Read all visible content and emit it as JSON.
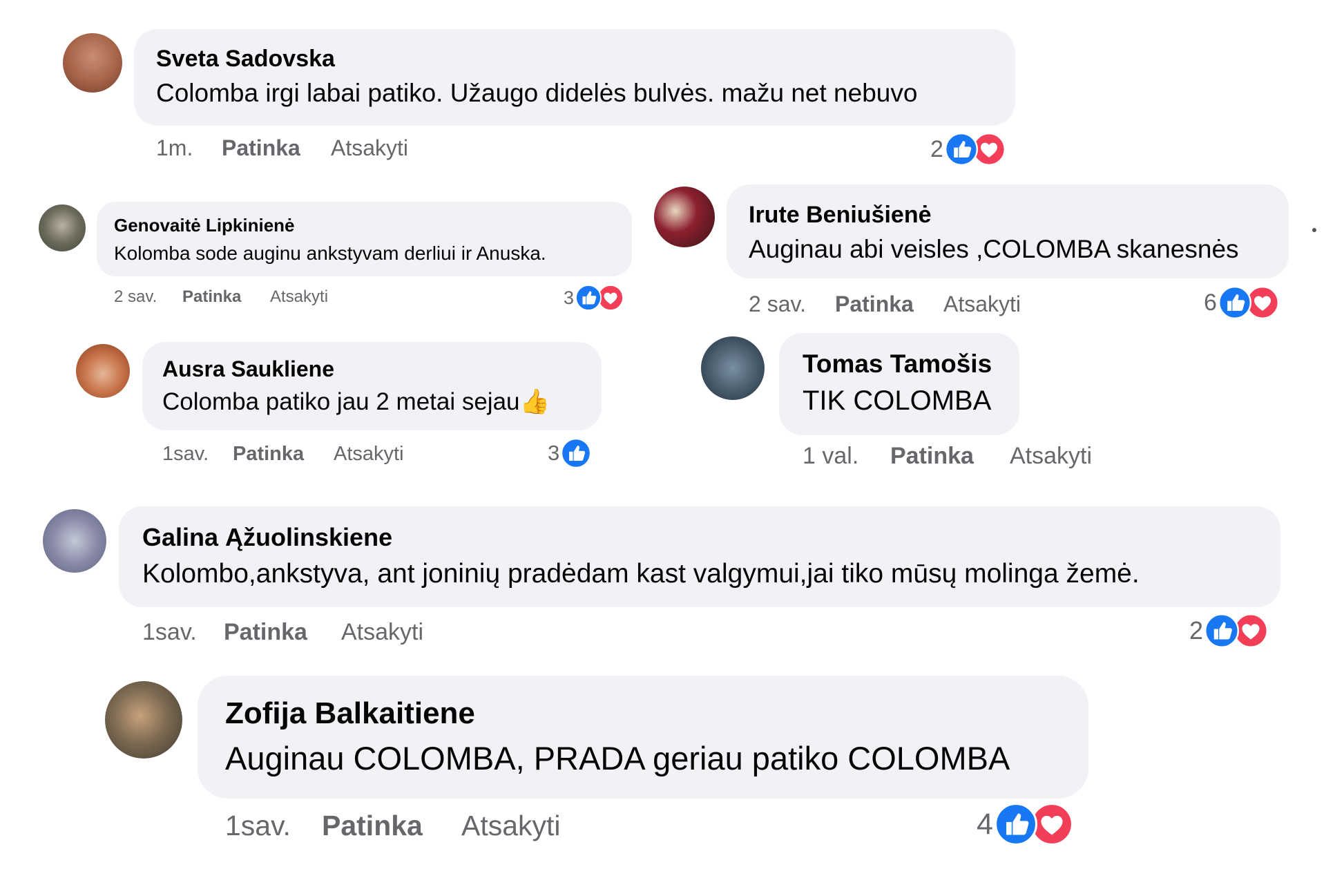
{
  "colors": {
    "like": "#1877f2",
    "love": "#f33e58",
    "bubble": "#f0f2f5",
    "meta": "#65676b"
  },
  "comments": [
    {
      "author": "Sveta Sadovska",
      "text": "Colomba irgi labai patiko. Užaugo didelės bulvės. mažu net nebuvo",
      "time": "1m.",
      "like_label": "Patinka",
      "reply_label": "Atsakyti",
      "reactions": "2",
      "reaction_types": [
        "like-icon",
        "love-icon"
      ]
    },
    {
      "author": "Genovaitė Lipkinienė",
      "text": "Kolomba sode auginu ankstyvam derliui ir Anuska.",
      "time": "2 sav.",
      "like_label": "Patinka",
      "reply_label": "Atsakyti",
      "reactions": "3",
      "reaction_types": [
        "like-icon",
        "love-icon"
      ]
    },
    {
      "author": "Irute Beniušienė",
      "text": "Auginau abi veisles ,COLOMBA skanesnės",
      "time": "2 sav.",
      "like_label": "Patinka",
      "reply_label": "Atsakyti",
      "reactions": "6",
      "reaction_types": [
        "like-icon",
        "love-icon"
      ]
    },
    {
      "author": "Ausra Saukliene",
      "text": "Colomba patiko jau 2 metai sejau",
      "text_emoji": "👍",
      "time": "1sav.",
      "like_label": "Patinka",
      "reply_label": "Atsakyti",
      "reactions": "3",
      "reaction_types": [
        "like-icon"
      ]
    },
    {
      "author": "Tomas Tamošis",
      "text": "TIK COLOMBA",
      "time": "1 val.",
      "like_label": "Patinka",
      "reply_label": "Atsakyti",
      "reactions": "",
      "reaction_types": []
    },
    {
      "author": "Galina Ąžuolinskiene",
      "text": "Kolombo,ankstyva, ant joninių pradėdam kast valgymui,jai tiko mūsų molinga žemė.",
      "time": "1sav.",
      "like_label": "Patinka",
      "reply_label": "Atsakyti",
      "reactions": "2",
      "reaction_types": [
        "like-icon",
        "love-icon"
      ]
    },
    {
      "author": "Zofija Balkaitiene",
      "text": "Auginau COLOMBA, PRADA geriau patiko COLOMBA",
      "time": "1sav.",
      "like_label": "Patinka",
      "reply_label": "Atsakyti",
      "reactions": "4",
      "reaction_types": [
        "like-icon",
        "love-icon"
      ]
    }
  ]
}
